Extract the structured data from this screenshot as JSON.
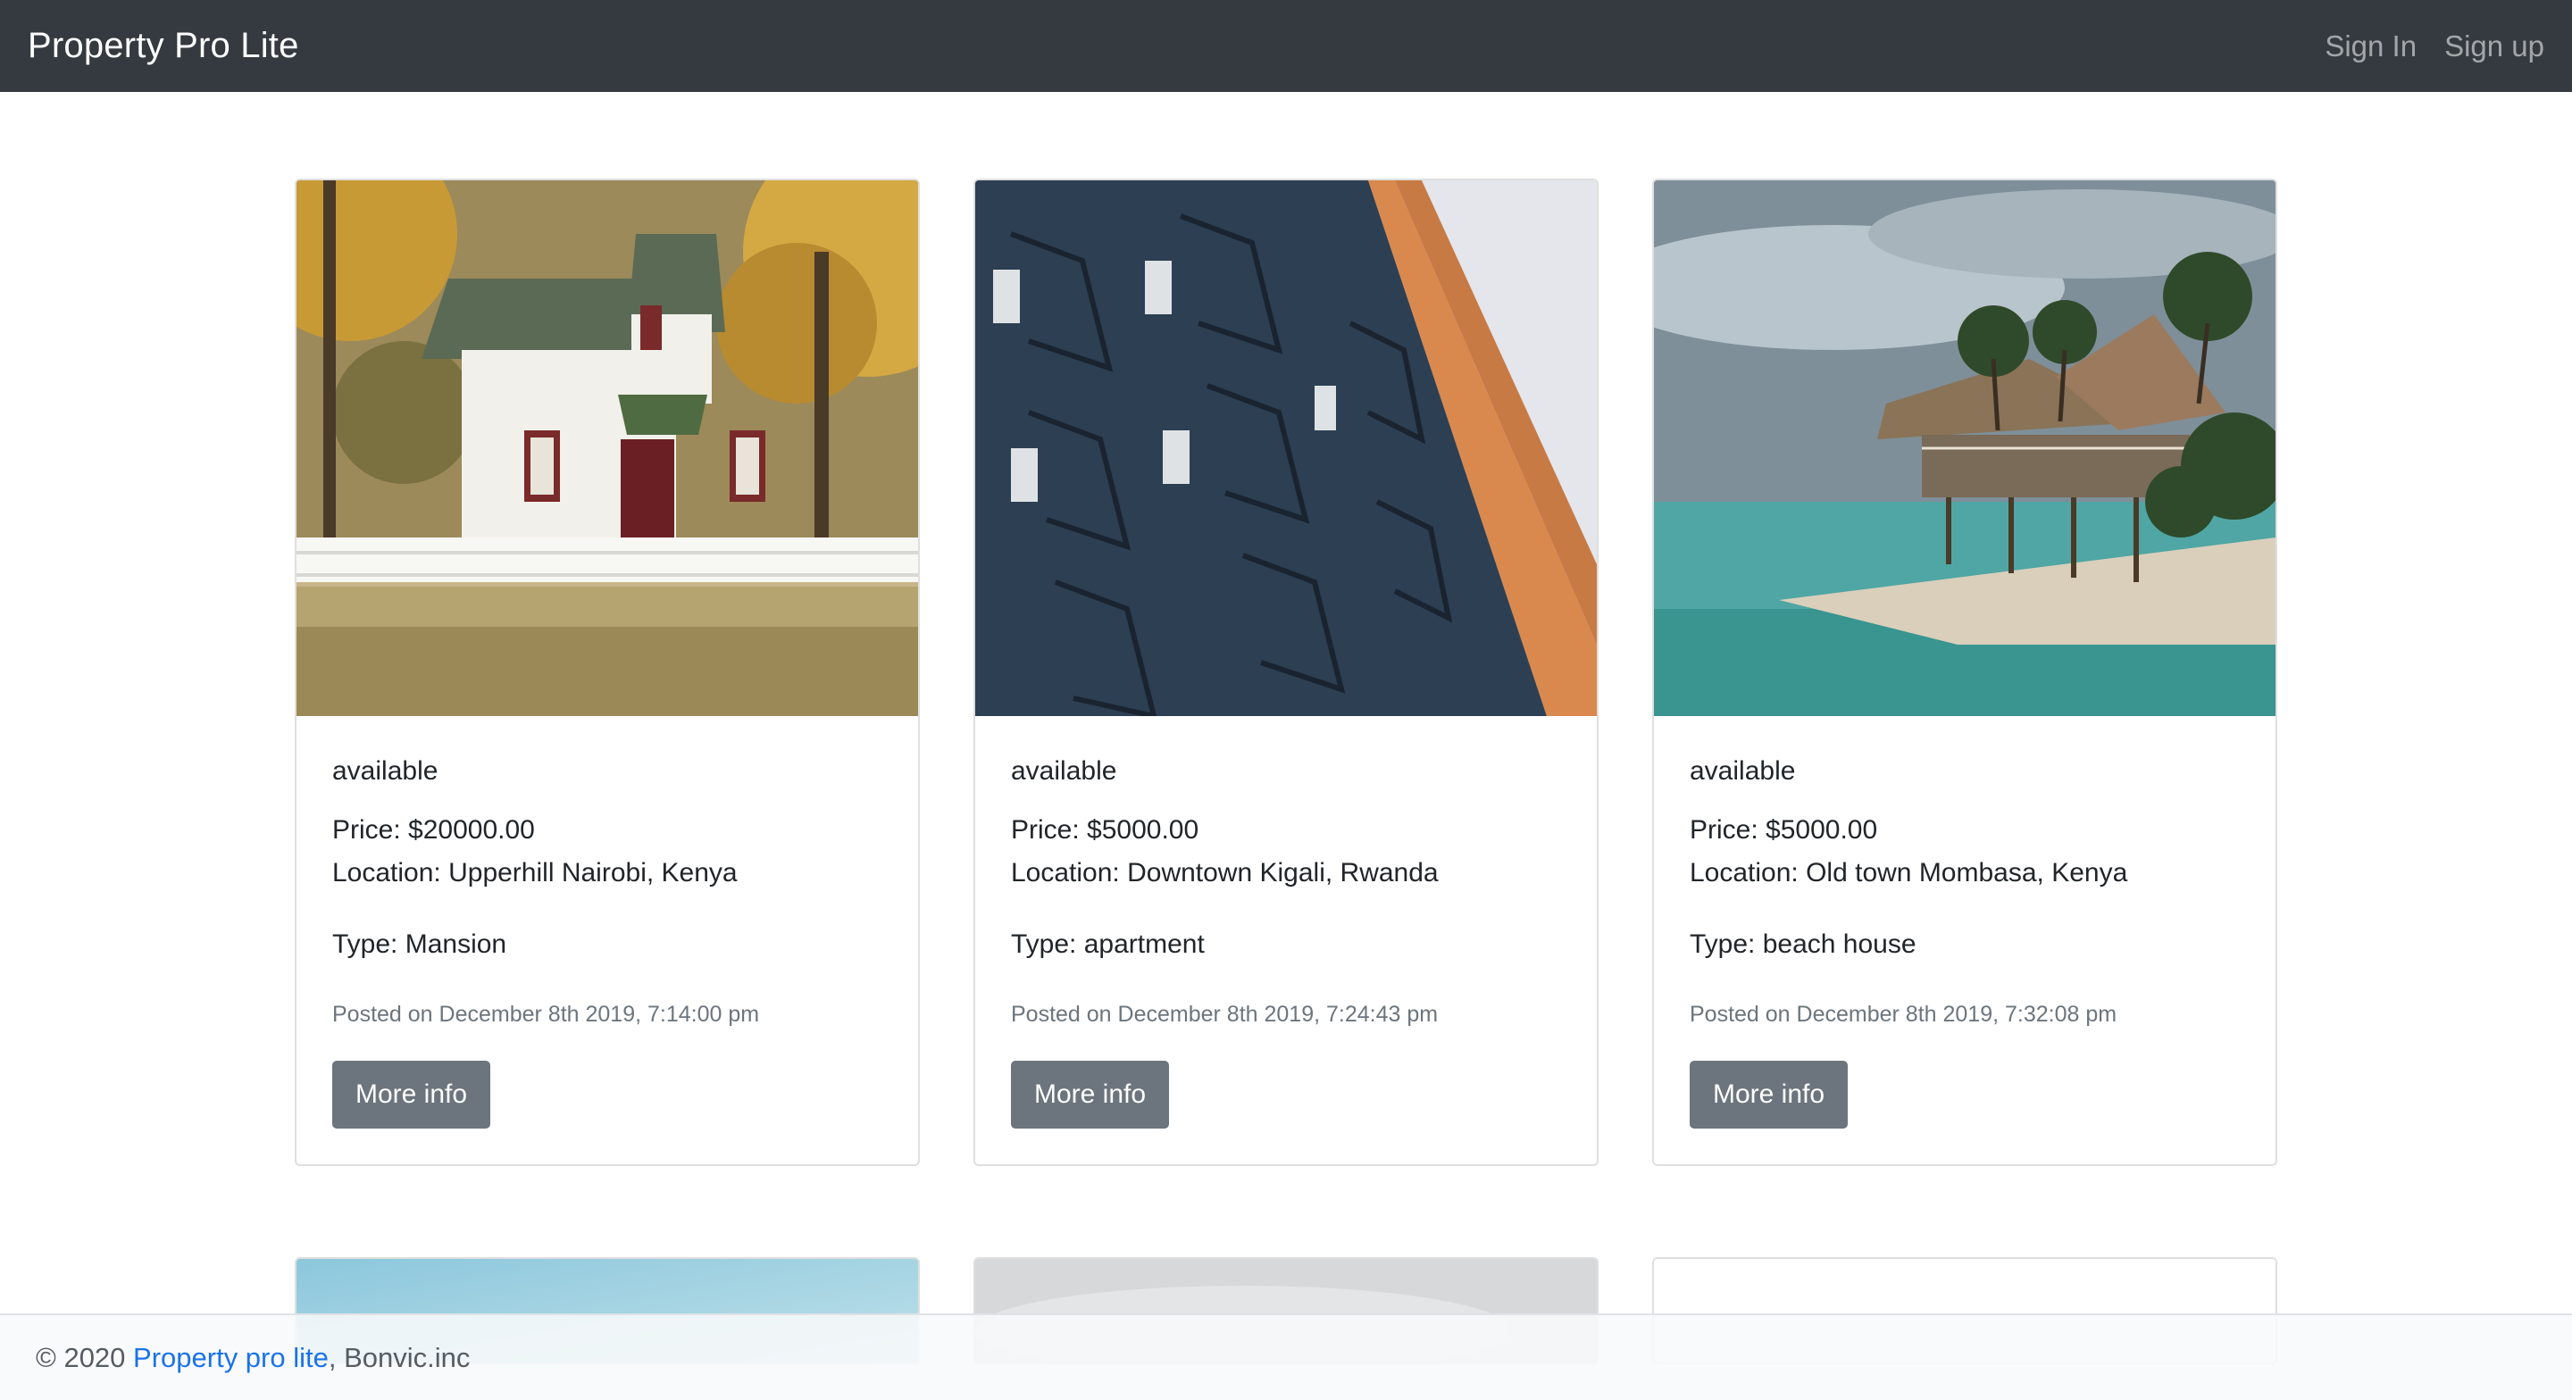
{
  "navbar": {
    "brand": "Property Pro Lite",
    "sign_in": "Sign In",
    "sign_up": "Sign up"
  },
  "properties": [
    {
      "status": "available",
      "price": "Price: $20000.00",
      "location": "Location: Upperhill Nairobi, Kenya",
      "type": "Type: Mansion",
      "posted": "Posted on December 8th 2019, 7:14:00 pm",
      "button": "More info"
    },
    {
      "status": "available",
      "price": "Price: $5000.00",
      "location": "Location: Downtown Kigali, Rwanda",
      "type": "Type: apartment",
      "posted": "Posted on December 8th 2019, 7:24:43 pm",
      "button": "More info"
    },
    {
      "status": "available",
      "price": "Price: $5000.00",
      "location": "Location: Old town Mombasa, Kenya",
      "type": "Type: beach house",
      "posted": "Posted on December 8th 2019, 7:32:08 pm",
      "button": "More info"
    }
  ],
  "footer": {
    "copyright": "© 2020 ",
    "link": "Property pro lite",
    "suffix": ", Bonvic.inc"
  },
  "colors": {
    "navbar": "#343a40",
    "button": "#6c757d",
    "link": "#1a73e8"
  }
}
